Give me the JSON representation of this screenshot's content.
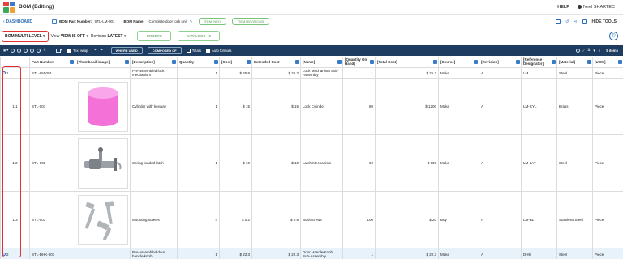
{
  "app": {
    "title": "BOM (Editing)"
  },
  "top_right": {
    "help": "HELP",
    "user": "Neel SHARTEC"
  },
  "header": {
    "back_label": "DASHBOARD",
    "part_number_label": "BOM Part Number:",
    "part_number_value": "STL-LM-001",
    "bom_name_label": "BOM Name",
    "bom_name_value": "Complete door lock unit",
    "info_button": "ITEM INFO",
    "revisions_button": "ITEM REVISIONS",
    "hide_tools": "HIDE TOOLS"
  },
  "view_bar": {
    "bom_level": "BOM MULTI-LEVEL",
    "view_prefix": "View",
    "view_value": "VIEW IS OFF",
    "revision_prefix": "Revision",
    "revision_value": "LATEST",
    "orders_tab": "ORDERS",
    "catalogs_tab": "CATALOGS - 2"
  },
  "toolbar": {
    "text_wrap": "Text wrap",
    "where_used": "WHERE USED",
    "composed_of": "COMPOSED OF",
    "totals": "Totals",
    "auto_formula": "Auto formula",
    "items_count": "5 items"
  },
  "table": {
    "columns": [
      "",
      "Part Number",
      "[Thumbnail image]",
      "[Description]",
      "Quantity",
      "[Cost]",
      "Extended Cost",
      "[Name]",
      "[Quantity On Hand]",
      "[Total Cost]",
      "[Source]",
      "[Revision]",
      "[Reference Designator]",
      "[Material]",
      "[UOM]"
    ],
    "rows": [
      {
        "level": "1",
        "part": "STL-LM-001",
        "thumb": "",
        "desc": "Pre-assembled lock mechanism",
        "qty": "1",
        "cost": "$ 25.8",
        "ext": "$ 25.2",
        "name": "Lock Mechanism Sub-Assembly",
        "onhand": "1",
        "total": "$ 25.2",
        "source": "Make",
        "rev": "A",
        "ref": "LM",
        "material": "Steel",
        "uom": "Piece"
      },
      {
        "level": "1.1",
        "part": "STL-001",
        "thumb": "cylinder",
        "desc": "Cylinder with keyway",
        "qty": "1",
        "cost": "$ 15",
        "ext": "$ 15",
        "name": "Lock Cylinder",
        "onhand": "80",
        "total": "$ 1200",
        "source": "Make",
        "rev": "A",
        "ref": "LM-CYL",
        "material": "Brass",
        "uom": "Piece"
      },
      {
        "level": "1.2",
        "part": "STL-002",
        "thumb": "latch",
        "desc": "Spring-loaded latch",
        "qty": "1",
        "cost": "$ 10",
        "ext": "$ 10",
        "name": "Latch Mechanism",
        "onhand": "60",
        "total": "$ 600",
        "source": "Make",
        "rev": "A",
        "ref": "LM-LAT",
        "material": "Steel",
        "uom": "Piece"
      },
      {
        "level": "1.3",
        "part": "STL-003",
        "thumb": "screws",
        "desc": "Mounting screws",
        "qty": "4",
        "cost": "$ 0.2",
        "ext": "$ 0.8",
        "name": "Bolt/Screws",
        "onhand": "100",
        "total": "$ 20",
        "source": "Buy",
        "rev": "A",
        "ref": "LM-BLT",
        "material": "Stainless Steel",
        "uom": "Piece"
      },
      {
        "level": "2",
        "part": "STL-DHK-001",
        "thumb": "",
        "desc": "Pre-assembled door handle/knob",
        "qty": "1",
        "cost": "$ 22.3",
        "ext": "$ 22.3",
        "name": "Door Handle/Knob Sub-Assembly",
        "onhand": "1",
        "total": "$ 22.3",
        "source": "Make",
        "rev": "A",
        "ref": "DHK",
        "material": "Steel",
        "uom": "Piece"
      }
    ]
  }
}
